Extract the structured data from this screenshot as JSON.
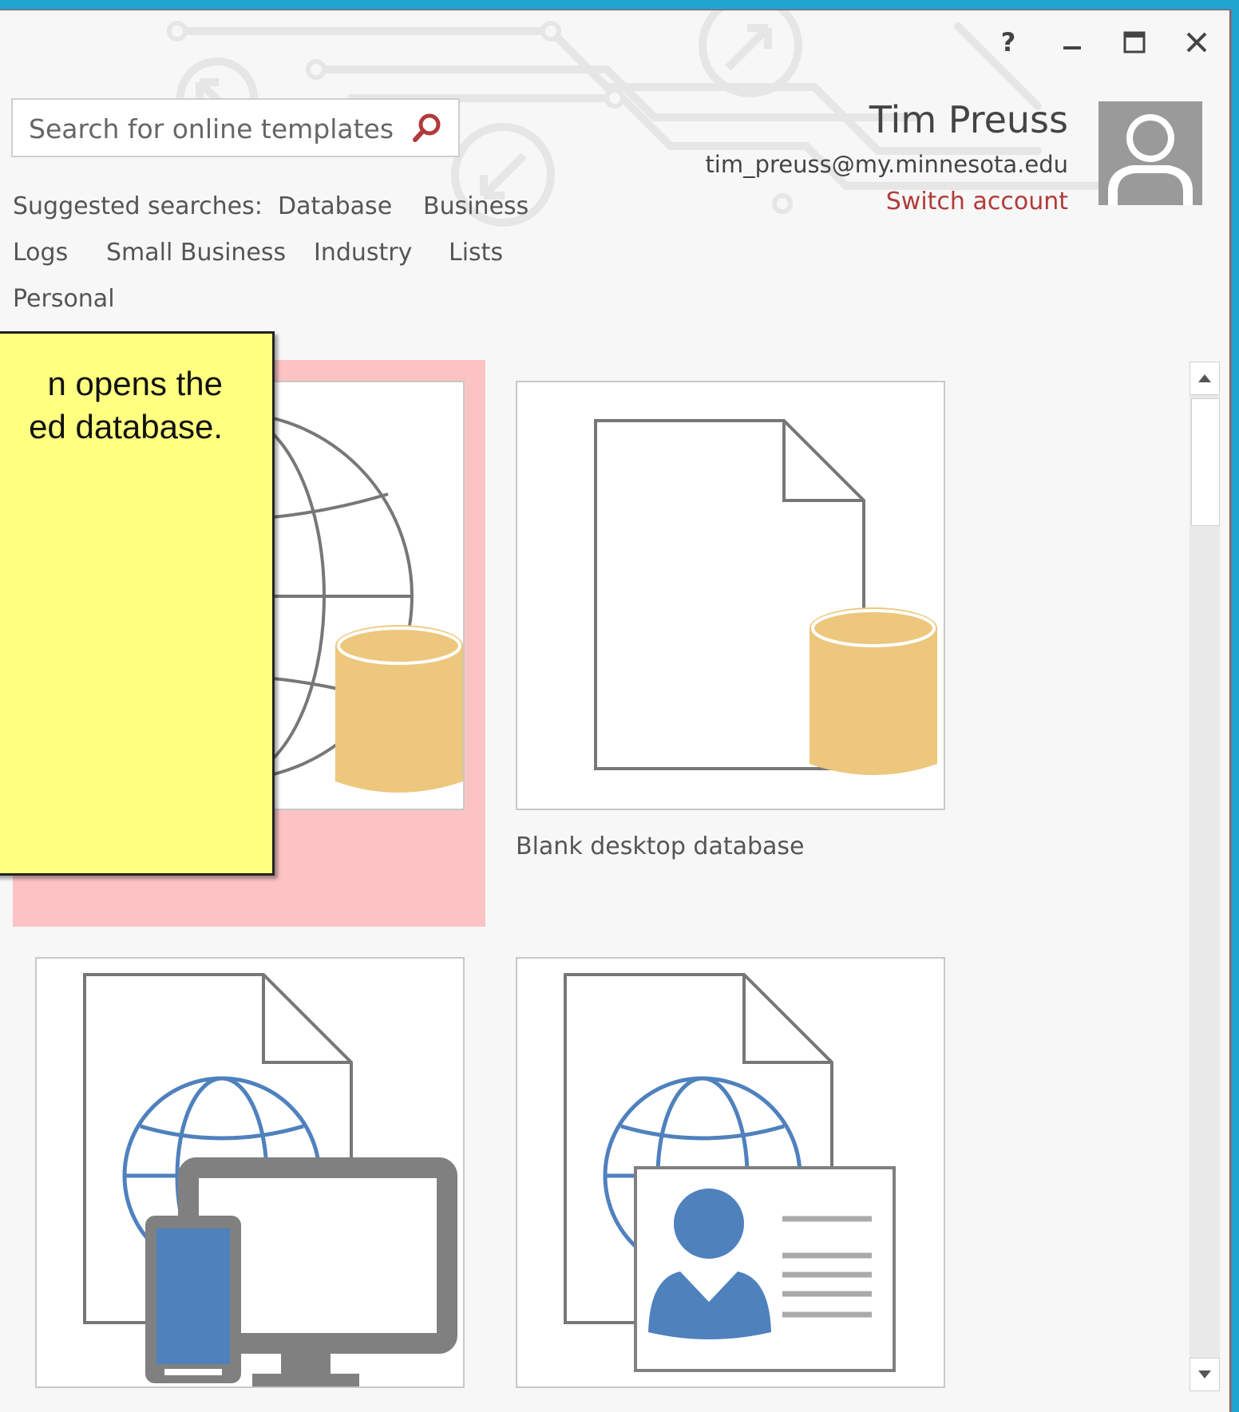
{
  "window_controls": {
    "help": "?",
    "minimize": "–",
    "maximize": "□",
    "close": "✕"
  },
  "search": {
    "placeholder": "Search for online templates",
    "value": "",
    "icon": "search-icon"
  },
  "suggested": {
    "label": "Suggested searches:",
    "items": [
      "Database",
      "Business",
      "Logs",
      "Small Business",
      "Industry",
      "Lists",
      "Personal"
    ]
  },
  "account": {
    "name": "Tim Preuss",
    "email": "tim_preuss@my.minnesota.edu",
    "switch_label": "Switch account",
    "avatar_icon": "person-icon"
  },
  "callout": {
    "line1": "n opens the",
    "line2": "ed database."
  },
  "templates": [
    {
      "label": "",
      "icon": "globe-database-icon",
      "selected": true
    },
    {
      "label": "Blank desktop database",
      "icon": "blank-document-database-icon",
      "selected": false
    },
    {
      "label": "",
      "icon": "web-app-devices-icon",
      "selected": false
    },
    {
      "label": "",
      "icon": "web-contacts-icon",
      "selected": false
    }
  ],
  "colors": {
    "accent": "#b23a3a",
    "highlight": "#fbc3c4",
    "callout": "#ffff80",
    "db_gold": "#ecc77d",
    "web_blue": "#4f81bd"
  }
}
